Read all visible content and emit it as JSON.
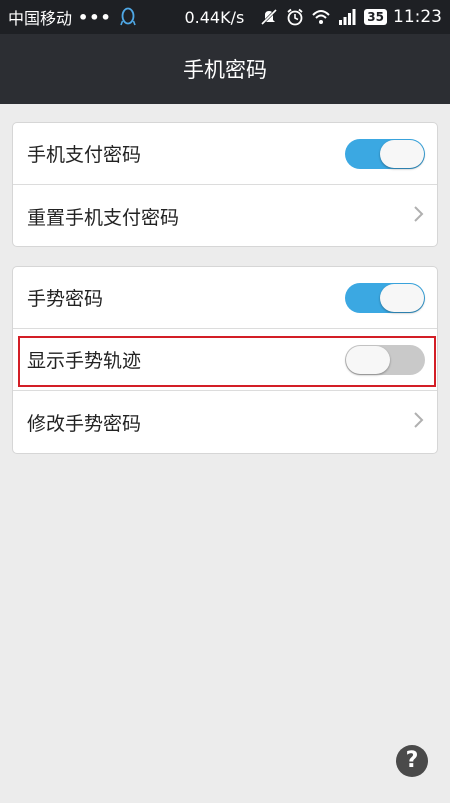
{
  "status_bar": {
    "carrier": "中国移动",
    "dots": "•••",
    "speed": "0.44K/s",
    "battery": "35",
    "time": "11:23",
    "icons": [
      "qq-penguin-icon",
      "mute-icon",
      "alarm-icon",
      "wifi-icon",
      "signal-icon",
      "battery-icon"
    ]
  },
  "header": {
    "title": "手机密码"
  },
  "payment_group": {
    "items": [
      {
        "label": "手机支付密码",
        "control": "toggle",
        "state": "on"
      },
      {
        "label": "重置手机支付密码",
        "control": "chevron"
      }
    ]
  },
  "gesture_group": {
    "items": [
      {
        "label": "手势密码",
        "control": "toggle",
        "state": "on"
      },
      {
        "label": "显示手势轨迹",
        "control": "toggle",
        "state": "off"
      },
      {
        "label": "修改手势密码",
        "control": "chevron"
      }
    ]
  },
  "help": {
    "label": "?"
  },
  "colors": {
    "accent": "#3ba8e2",
    "header_bg": "#2c2e33",
    "status_bg": "#1e2024",
    "page_bg": "#ececec",
    "highlight": "#d31e26"
  }
}
